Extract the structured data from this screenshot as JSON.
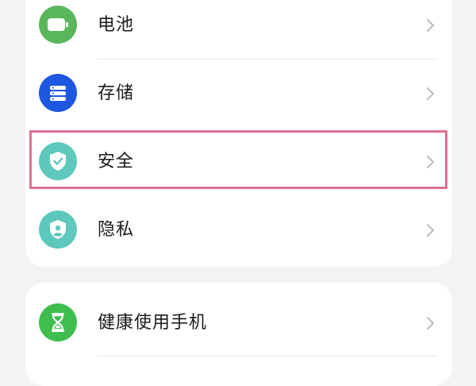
{
  "settings": {
    "items": [
      {
        "label": "电池",
        "icon": "battery-icon",
        "icon_color": "#5ab65b"
      },
      {
        "label": "存储",
        "icon": "storage-icon",
        "icon_color": "#1e57e0"
      },
      {
        "label": "安全",
        "icon": "shield-check-icon",
        "icon_color": "#5ec8bd"
      },
      {
        "label": "隐私",
        "icon": "privacy-shield-icon",
        "icon_color": "#5ec8bd"
      },
      {
        "label": "健康使用手机",
        "icon": "hourglass-icon",
        "icon_color": "#3fbd4f"
      }
    ]
  },
  "highlight": {
    "color": "#e0708f",
    "target": "安全"
  },
  "colors": {
    "background": "#f1f3f5",
    "card": "#ffffff",
    "chevron": "#b9bcc0"
  }
}
